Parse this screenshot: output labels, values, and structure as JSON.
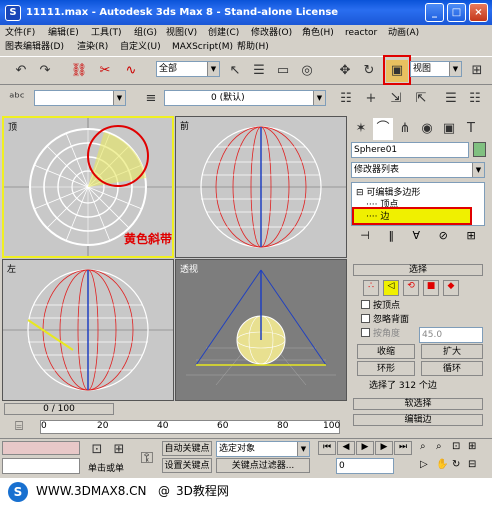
{
  "window": {
    "title": "11111.max - Autodesk 3ds Max 8 - Stand-alone License",
    "minimize": "_",
    "maximize": "□",
    "close": "×"
  },
  "menu": {
    "row1": [
      "文件(F)",
      "编辑(E)",
      "工具(T)",
      "组(G)",
      "视图(V)",
      "创建(C)",
      "修改器(O)",
      "角色(H)",
      "reactor",
      "动画(A)"
    ],
    "row2": [
      "图表编辑器(D)",
      "渲染(R)",
      "自定义(U)",
      "MAXScript(M)",
      "帮助(H)"
    ]
  },
  "toolbar": {
    "selection_filter": "全部",
    "ref_coord": "视图"
  },
  "layer": {
    "label": "0 (默认)"
  },
  "viewports": {
    "top": "顶",
    "front": "前",
    "left": "左",
    "perspective": "透视"
  },
  "annotation": {
    "text": "黄色斜带"
  },
  "command_panel": {
    "object_name": "Sphere01",
    "modifier_list": "修改器列表",
    "stack": {
      "root": "可编辑多边形",
      "sub1": "顶点",
      "sub2": "边"
    },
    "selection_rollout": "选择",
    "by_vertex": "按顶点",
    "ignore_backfacing": "忽略背面",
    "by_angle": "按角度",
    "angle_value": "45.0",
    "shrink": "收缩",
    "grow": "扩大",
    "ring": "环形",
    "loop": "循环",
    "status": "选择了 312 个边",
    "soft_selection": "软选择",
    "edit_edges": "编辑边"
  },
  "timeline": {
    "frame": "0 / 100",
    "ticks": [
      "0",
      "20",
      "40",
      "60",
      "80",
      "100"
    ]
  },
  "status": {
    "auto_key": "自动关键点",
    "set_key": "设置关键点",
    "selected_obj": "选定对象",
    "key_filters": "关键点过滤器...",
    "single_click": "单击或单",
    "frame_input": "0"
  },
  "watermark": {
    "left": "WWW.3DMAX8.CN",
    "at": "@",
    "right": "3D教程网"
  }
}
